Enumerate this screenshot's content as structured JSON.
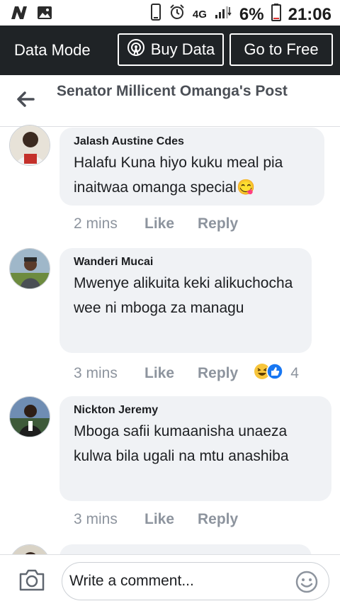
{
  "status_bar": {
    "network": "4G",
    "battery": "6%",
    "time": "21:06"
  },
  "data_bar": {
    "mode_label": "Data Mode",
    "buy_label": "Buy Data",
    "free_label": "Go to Free"
  },
  "header": {
    "title": "Senator Millicent Omanga's Post"
  },
  "comments": [
    {
      "author": "Jalash Austine Cdes",
      "text": "Halafu Kuna hiyo kuku meal pia inaitwaa omanga special",
      "emoji": "😋",
      "time": "2 mins",
      "like": "Like",
      "reply": "Reply"
    },
    {
      "author": "Wanderi Mucai",
      "text": "Mwenye alikuita keki alikuchocha wee ni mboga za managu",
      "time": "3 mins",
      "like": "Like",
      "reply": "Reply",
      "reaction_count": "4"
    },
    {
      "author": "Nickton Jeremy",
      "text": "Mboga safii kumaanisha unaeza kulwa bila ugali na mtu anashiba",
      "time": "3 mins",
      "like": "Like",
      "reply": "Reply"
    }
  ],
  "composer": {
    "placeholder": "Write a comment..."
  }
}
